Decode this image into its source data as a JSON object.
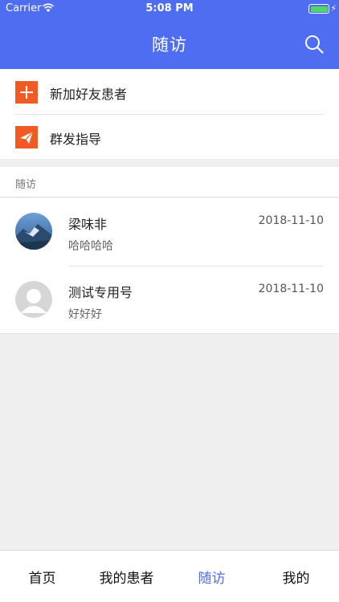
{
  "status_bar": {
    "carrier": "Carrier",
    "time": "5:08 PM"
  },
  "header": {
    "title": "随访",
    "search_icon": "search-icon",
    "bg_color": "#4e6df0"
  },
  "menu": [
    {
      "label": "新加好友患者",
      "icon": "plus-icon",
      "color": "#f15a22"
    },
    {
      "label": "群发指导",
      "icon": "paper-plane-icon",
      "color": "#f15a22"
    }
  ],
  "section": {
    "title": "随访"
  },
  "followups": [
    {
      "name": "梁味非",
      "date": "2018-11-10",
      "message": "哈哈哈哈",
      "avatar": "photo-avatar"
    },
    {
      "name": "测试专用号",
      "date": "2018-11-10",
      "message": "好好好",
      "avatar": "default-avatar"
    }
  ],
  "tabbar": {
    "tabs": [
      {
        "label": "首页",
        "active": false
      },
      {
        "label": "我的患者",
        "active": false
      },
      {
        "label": "随访",
        "active": true
      },
      {
        "label": "我的",
        "active": false
      }
    ],
    "active_color": "#4e6df0"
  }
}
